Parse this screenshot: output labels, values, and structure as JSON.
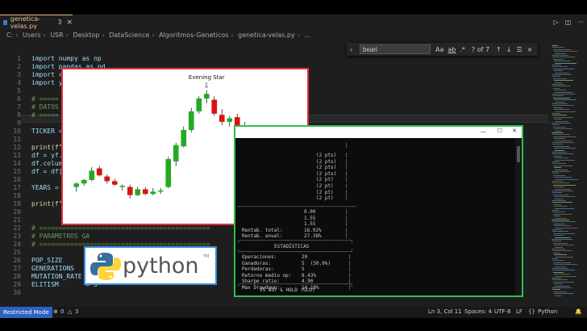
{
  "tab": {
    "filename": "genetica-velas.py",
    "problems": "3"
  },
  "breadcrumb": [
    "C:",
    "Users",
    "USR",
    "Desktop",
    "DataScience",
    "Algoritmos-Geneticos",
    "genetica-velas.py",
    "..."
  ],
  "find": {
    "query": "bearl",
    "options": [
      "Aa",
      "ab",
      ".*"
    ],
    "result": "? of 7"
  },
  "code_lines": [
    {
      "n": "1",
      "text": "import numpy as np"
    },
    {
      "n": "2",
      "text": "import pandas as pd"
    },
    {
      "n": "3",
      "text": "import r"
    },
    {
      "n": "4",
      "text": "import y"
    },
    {
      "n": "5",
      "text": ""
    },
    {
      "n": "6",
      "text": "# ====="
    },
    {
      "n": "7",
      "text": "# DATOS"
    },
    {
      "n": "8",
      "text": "# ====="
    },
    {
      "n": "9",
      "text": ""
    },
    {
      "n": "10",
      "text": "TICKER ="
    },
    {
      "n": "11",
      "text": ""
    },
    {
      "n": "12",
      "text": "print(f\"C"
    },
    {
      "n": "13",
      "text": "df = yf.d"
    },
    {
      "n": "14",
      "text": "df.colum"
    },
    {
      "n": "15",
      "text": "df = df["
    },
    {
      "n": "16",
      "text": ""
    },
    {
      "n": "17",
      "text": "YEARS = 5"
    },
    {
      "n": "18",
      "text": ""
    },
    {
      "n": "19",
      "text": "print(f\"C"
    },
    {
      "n": "20",
      "text": ""
    },
    {
      "n": "21",
      "text": ""
    },
    {
      "n": "22",
      "text": "# ============================================"
    },
    {
      "n": "23",
      "text": "# PARAMETROS GA"
    },
    {
      "n": "24",
      "text": "# ============================================"
    },
    {
      "n": "25",
      "text": ""
    },
    {
      "n": "26",
      "text": "POP_SIZE"
    },
    {
      "n": "27",
      "text": "GENERATIONS"
    },
    {
      "n": "28",
      "text": "MUTATION_RATE = 0.2"
    },
    {
      "n": "29",
      "text": "ELITISM       = 5"
    },
    {
      "n": "30",
      "text": ""
    }
  ],
  "statusbar": {
    "mode": "Restricted Mode",
    "errors": "0",
    "warnings": "3",
    "position": "Ln 3, Col 11",
    "spaces": "Spaces: 4",
    "encoding": "UTF-8",
    "eol": "LF",
    "language": "Python"
  },
  "chart_data": {
    "type": "candlestick",
    "title": "",
    "annotation": "Evening Star",
    "colors": {
      "up": "#22aa22",
      "down": "#dd1111"
    },
    "candles": [
      {
        "o": 5.6,
        "h": 6.0,
        "l": 5.2,
        "c": 5.9
      },
      {
        "o": 5.9,
        "h": 6.3,
        "l": 5.7,
        "c": 6.2
      },
      {
        "o": 6.2,
        "h": 7.3,
        "l": 6.1,
        "c": 7.0
      },
      {
        "o": 7.2,
        "h": 7.4,
        "l": 6.5,
        "c": 6.6
      },
      {
        "o": 6.5,
        "h": 6.7,
        "l": 5.9,
        "c": 6.1
      },
      {
        "o": 6.1,
        "h": 6.3,
        "l": 5.7,
        "c": 5.8
      },
      {
        "o": 5.6,
        "h": 5.8,
        "l": 5.3,
        "c": 5.7
      },
      {
        "o": 5.6,
        "h": 5.8,
        "l": 4.6,
        "c": 4.9
      },
      {
        "o": 4.9,
        "h": 5.6,
        "l": 4.8,
        "c": 5.4
      },
      {
        "o": 5.4,
        "h": 5.6,
        "l": 4.9,
        "c": 5.0
      },
      {
        "o": 5.0,
        "h": 5.5,
        "l": 4.9,
        "c": 5.2
      },
      {
        "o": 5.2,
        "h": 5.5,
        "l": 5.0,
        "c": 5.3
      },
      {
        "o": 5.6,
        "h": 8.2,
        "l": 5.5,
        "c": 8.0
      },
      {
        "o": 7.8,
        "h": 9.4,
        "l": 7.4,
        "c": 9.2
      },
      {
        "o": 9.1,
        "h": 10.8,
        "l": 9.0,
        "c": 10.5
      },
      {
        "o": 10.5,
        "h": 12.4,
        "l": 10.3,
        "c": 12.1
      },
      {
        "o": 12.1,
        "h": 13.4,
        "l": 11.9,
        "c": 13.2
      },
      {
        "o": 13.2,
        "h": 13.9,
        "l": 12.8,
        "c": 13.6
      },
      {
        "o": 13.1,
        "h": 13.4,
        "l": 11.7,
        "c": 11.9
      },
      {
        "o": 11.8,
        "h": 12.3,
        "l": 10.9,
        "c": 11.2
      },
      {
        "o": 11.2,
        "h": 11.7,
        "l": 10.8,
        "c": 11.5
      },
      {
        "o": 11.6,
        "h": 11.9,
        "l": 10.6,
        "c": 10.7
      },
      {
        "o": 10.9,
        "h": 11.2,
        "l": 9.3,
        "c": 9.6
      },
      {
        "o": 9.6,
        "h": 9.8,
        "l": 8.2,
        "c": 8.4
      },
      {
        "o": 8.4,
        "h": 8.6,
        "l": 7.3,
        "c": 7.5
      },
      {
        "o": 7.6,
        "h": 7.8,
        "l": 6.9,
        "c": 7.1
      },
      {
        "o": 7.0,
        "h": 7.2,
        "l": 6.3,
        "c": 6.4
      },
      {
        "o": 6.4,
        "h": 6.9,
        "l": 5.4,
        "c": 5.6
      },
      {
        "o": 5.6,
        "h": 6.8,
        "l": 5.2,
        "c": 5.9
      },
      {
        "o": 5.9,
        "h": 6.0,
        "l": 4.6,
        "c": 4.9
      }
    ],
    "annotation_index": 17
  },
  "terminal": {
    "window_controls": [
      "—",
      "☐",
      "✕"
    ],
    "trades": [
      "(2 pts)",
      "(2 pts)",
      "(2 pts)",
      "(2 pts)",
      "(2 pt)",
      "(2 pt)",
      "(2 pt)",
      "(2 pt)"
    ],
    "metrics": [
      {
        "label": "",
        "value": "0.00"
      },
      {
        "label": "",
        "value": "1.55"
      },
      {
        "label": "",
        "value": "1.55"
      },
      {
        "label": "Rentab. total:",
        "value": "16.92%"
      },
      {
        "label": "Rentab. anual:",
        "value": "27.38%"
      }
    ],
    "stats_header": "ESTADÍSTICAS",
    "stats": [
      {
        "label": "Operaciones:",
        "value": "20"
      },
      {
        "label": "Ganadoras:",
        "value": "5  (50.0%)"
      },
      {
        "label": "Perdedoras:",
        "value": "5"
      },
      {
        "label": "Retorno medio op:",
        "value": "8.43%"
      },
      {
        "label": "Sharpe ratio:",
        "value": "4.90"
      },
      {
        "label": "Max Drawdown:",
        "value": "14.18%"
      }
    ],
    "vs_header": "VS BUY & HOLD (GLD)"
  },
  "python_logo": {
    "text": "python",
    "tm": "TM",
    "colors": {
      "blue": "#366e9e",
      "yellow": "#ffd43b"
    }
  }
}
